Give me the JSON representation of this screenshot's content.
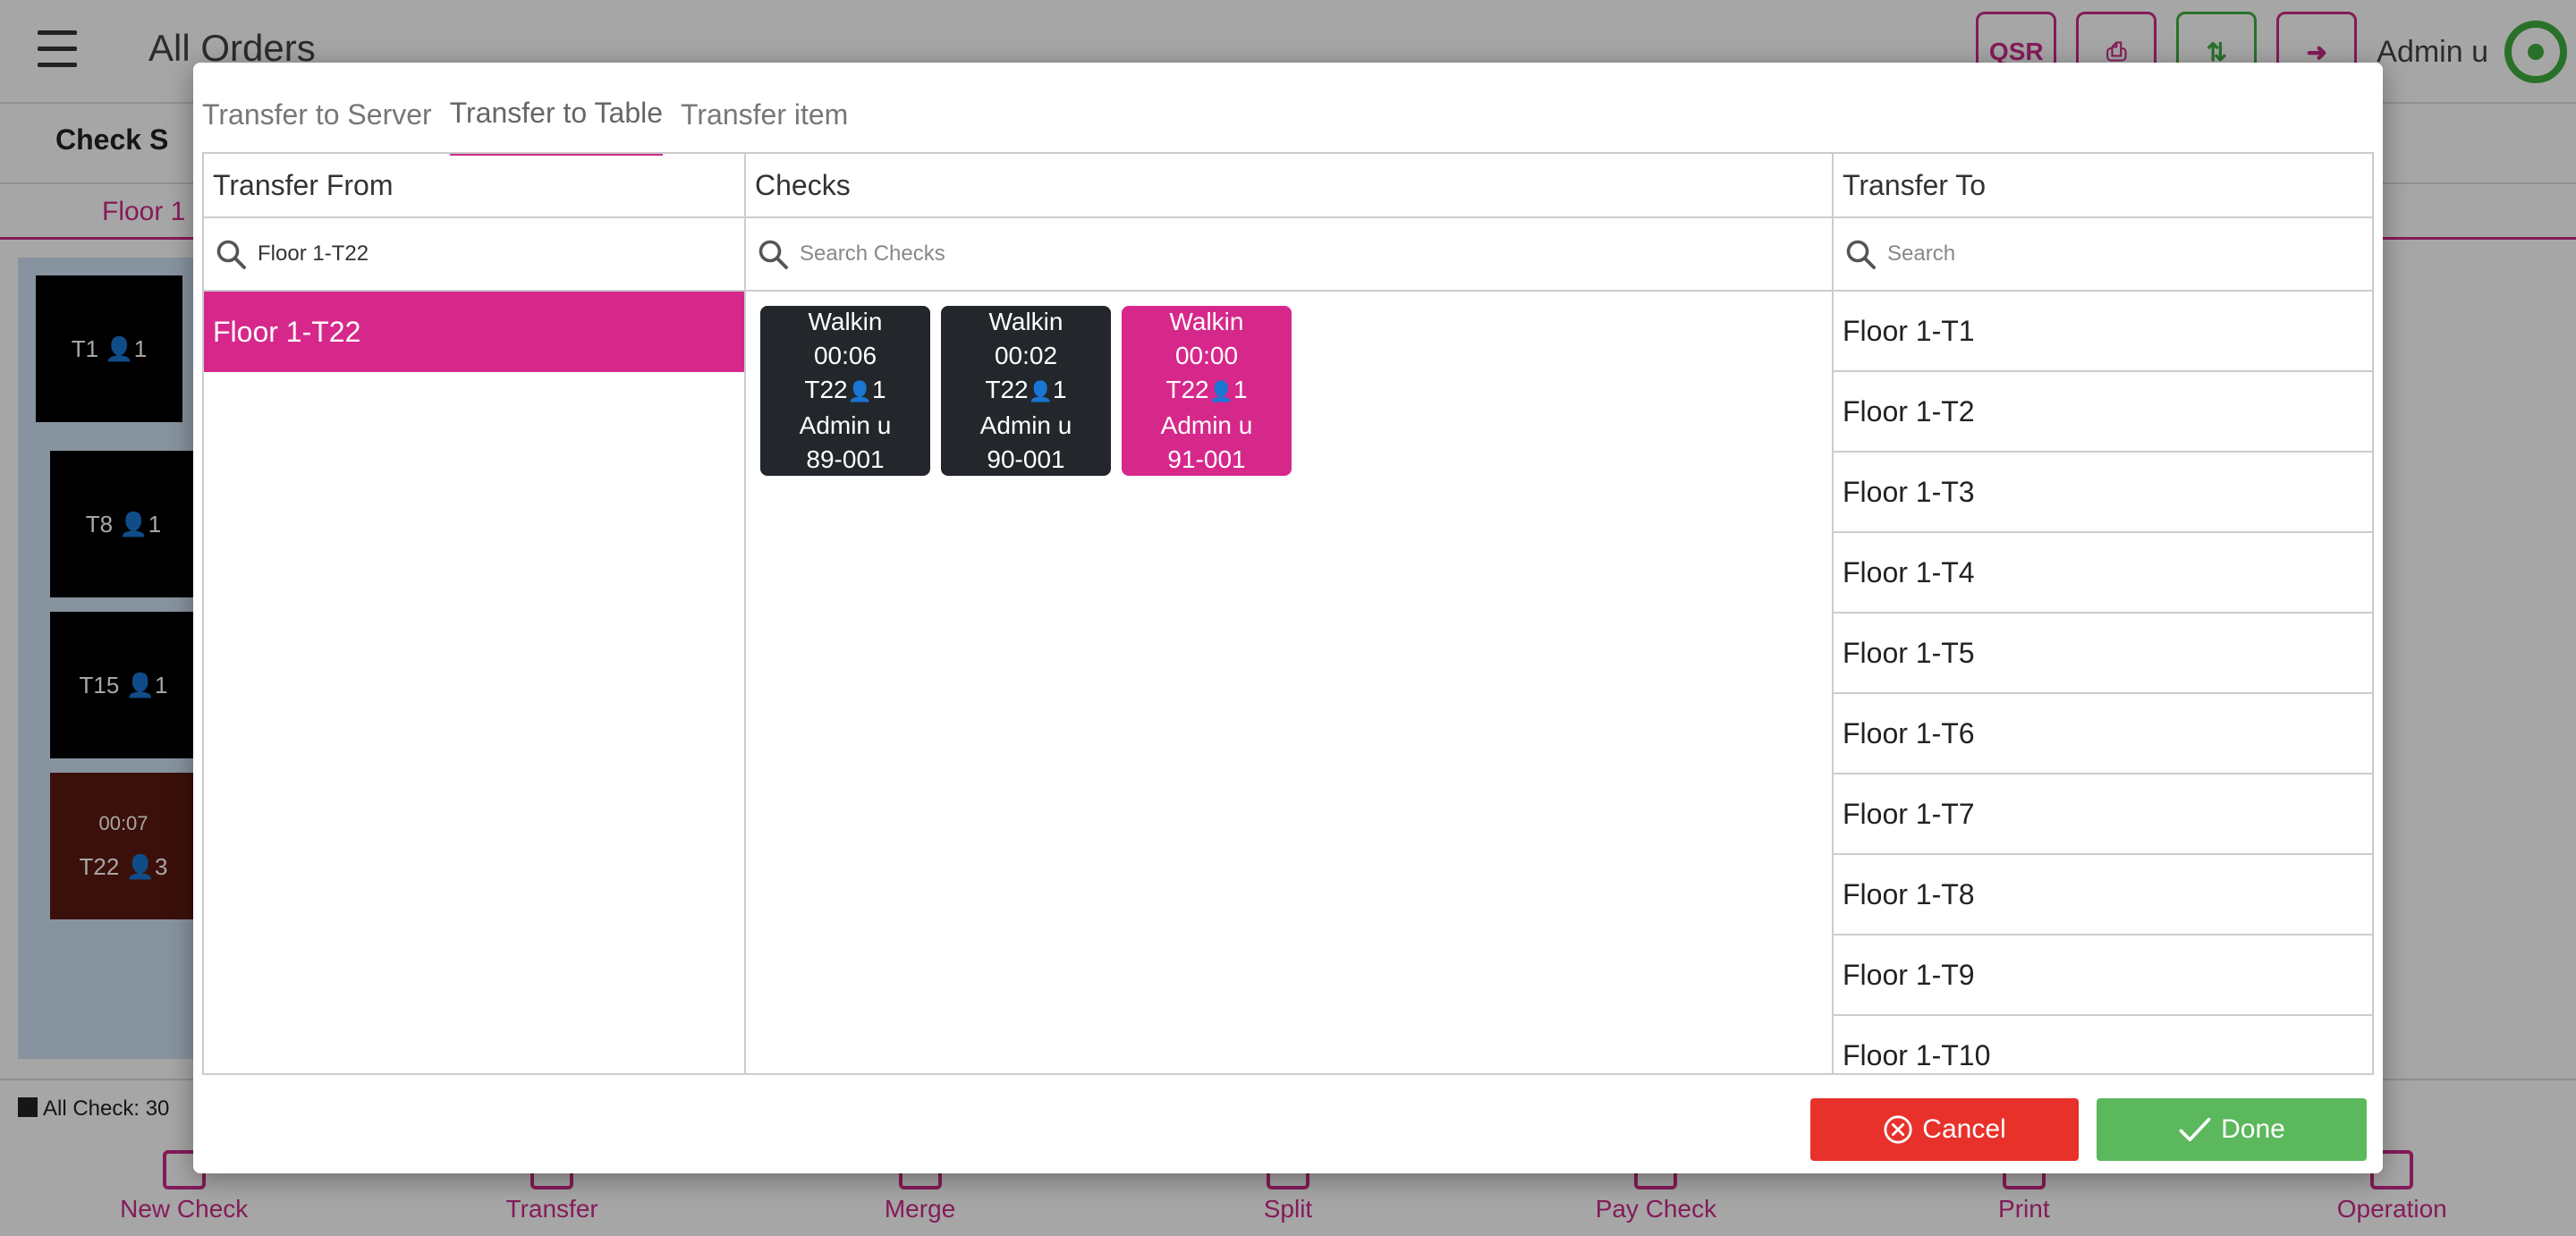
{
  "app": {
    "title": "All Orders",
    "qsr_label": "QSR",
    "user_name": "Admin u",
    "check_label": "Check S",
    "floor_tab": "Floor 1",
    "all_check": "All Check: 30"
  },
  "floor_tables": [
    {
      "label": "T1",
      "guests": "1",
      "time": ""
    },
    {
      "label": "T8",
      "guests": "1",
      "time": ""
    },
    {
      "label": "T15",
      "guests": "1",
      "time": ""
    },
    {
      "label": "T22",
      "guests": "3",
      "time": "00:07"
    }
  ],
  "bottom_nav": [
    "New Check",
    "Transfer",
    "Merge",
    "Split",
    "Pay Check",
    "Print",
    "Operation"
  ],
  "modal": {
    "tabs": [
      "Transfer to Server",
      "Transfer to Table",
      "Transfer item"
    ],
    "active_tab": "Transfer to Table",
    "transfer_from": {
      "header": "Transfer From",
      "search_value": "Floor 1-T22",
      "items": [
        "Floor 1-T22"
      ],
      "selected": "Floor 1-T22"
    },
    "checks": {
      "header": "Checks",
      "search_placeholder": "Search Checks",
      "cards": [
        {
          "type": "Walkin",
          "time": "00:06",
          "table": "T22",
          "guests": "1",
          "server": "Admin u",
          "number": "89-001",
          "selected": false
        },
        {
          "type": "Walkin",
          "time": "00:02",
          "table": "T22",
          "guests": "1",
          "server": "Admin u",
          "number": "90-001",
          "selected": false
        },
        {
          "type": "Walkin",
          "time": "00:00",
          "table": "T22",
          "guests": "1",
          "server": "Admin u",
          "number": "91-001",
          "selected": true
        }
      ]
    },
    "transfer_to": {
      "header": "Transfer To",
      "search_placeholder": "Search",
      "items": [
        "Floor 1-T1",
        "Floor 1-T2",
        "Floor 1-T3",
        "Floor 1-T4",
        "Floor 1-T5",
        "Floor 1-T6",
        "Floor 1-T7",
        "Floor 1-T8",
        "Floor 1-T9",
        "Floor 1-T10"
      ]
    },
    "buttons": {
      "cancel": "Cancel",
      "done": "Done"
    }
  },
  "colors": {
    "accent": "#d6288b",
    "cancel": "#e8312a",
    "done": "#5cb85c",
    "dark_card": "#23272b"
  }
}
